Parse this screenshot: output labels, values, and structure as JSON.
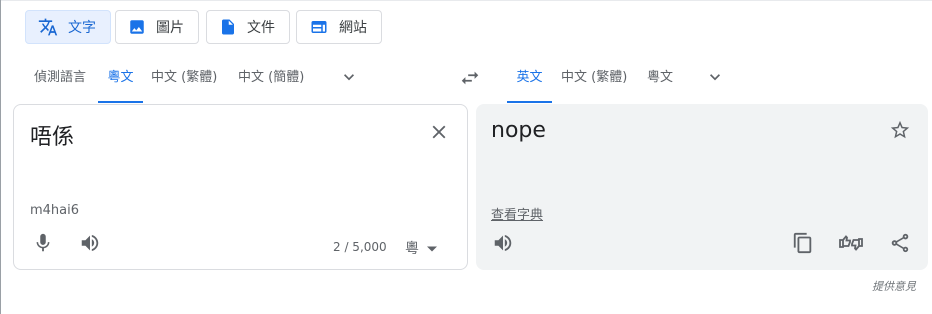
{
  "modes": [
    {
      "label": "文字",
      "icon": "translate-icon",
      "active": true
    },
    {
      "label": "圖片",
      "icon": "image-icon"
    },
    {
      "label": "文件",
      "icon": "document-icon"
    },
    {
      "label": "網站",
      "icon": "website-icon"
    }
  ],
  "source_langs": [
    "偵測語言",
    "粵文",
    "中文 (繁體)",
    "中文 (簡體)"
  ],
  "source_active": "粵文",
  "target_langs": [
    "英文",
    "中文 (繁體)",
    "粵文"
  ],
  "target_active": "英文",
  "source": {
    "text": "唔係",
    "romanization": "m4hai6",
    "char_count": "2 / 5,000",
    "ime_label": "粵"
  },
  "target": {
    "text": "nope",
    "dictionary_link": "查看字典"
  },
  "feedback_label": "提供意見",
  "colors": {
    "accent": "#1a73e8",
    "active_bg": "#e8f0fe",
    "target_panel_bg": "#f1f3f4"
  }
}
